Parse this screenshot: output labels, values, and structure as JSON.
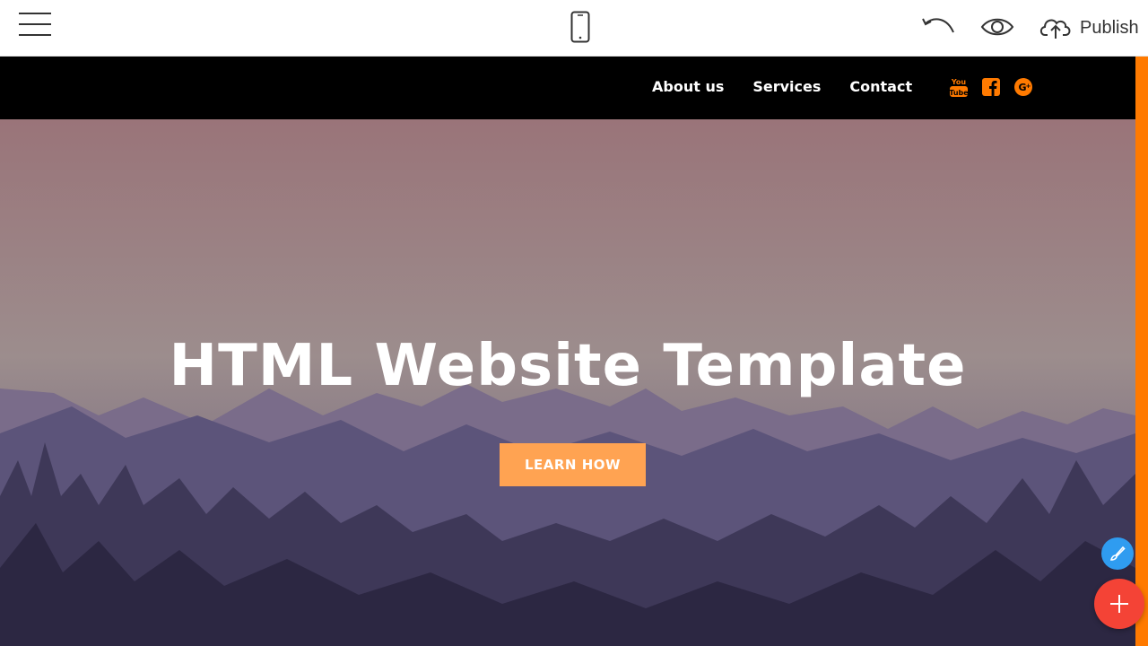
{
  "toolbar": {
    "publish_label": "Publish",
    "icons": [
      "menu-icon",
      "mobile-device-icon",
      "undo-icon",
      "eye-icon",
      "cloud-upload-icon"
    ]
  },
  "nav": {
    "links": [
      "About us",
      "Services",
      "Contact"
    ],
    "social": [
      "youtube-icon",
      "facebook-icon",
      "google-plus-icon"
    ],
    "social_color": "#ff7a00"
  },
  "hero": {
    "title": "HTML Website Template",
    "cta_label": "LEARN HOW",
    "cta_color": "#ffa352"
  },
  "colors": {
    "accent": "#ff7a00",
    "fab_edit": "#2f9cf0",
    "fab_add": "#f44336"
  }
}
